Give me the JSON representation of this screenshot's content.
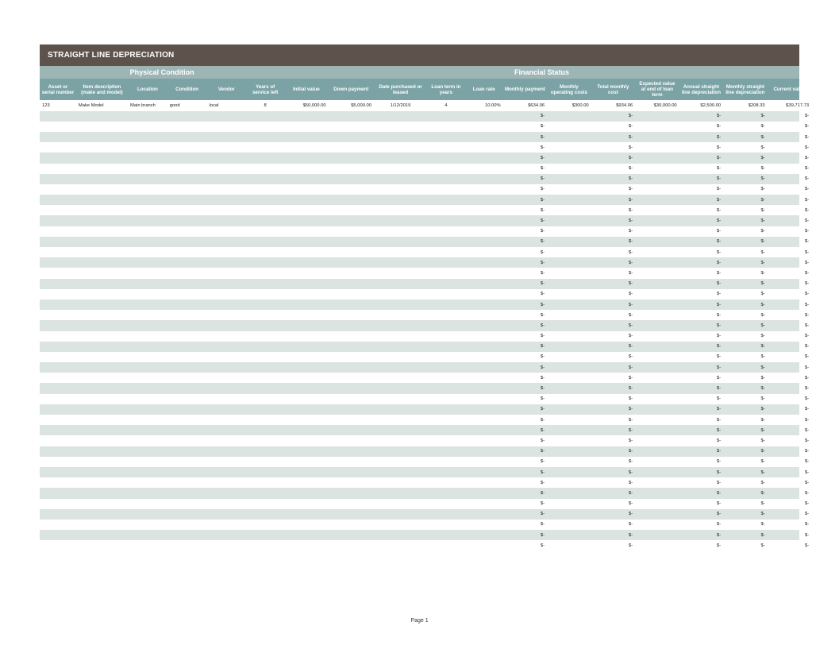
{
  "title": "STRAIGHT LINE DEPRECIATION",
  "groups": {
    "physical": "Physical Condition",
    "financial": "Financial Status"
  },
  "headers": [
    "Asset or serial number",
    "Item description (make and model)",
    "Location",
    "Condition",
    "Vendor",
    "Years of service left",
    "Initial value",
    "Down payment",
    "Date purchased or leased",
    "Loan term in years",
    "Loan rate",
    "Monthly payment",
    "Monthly operating costs",
    "Total monthly cost",
    "Expected value at end of loan term",
    "Annual straight line depreciation",
    "Monthly straight line depreciation",
    "Current value"
  ],
  "first_row": {
    "asset_serial": "123",
    "item_description": "Make Model",
    "location": "Main branch",
    "condition": "good",
    "vendor": "local",
    "years_service_left": "8",
    "initial_value": "$50,000.00",
    "down_payment": "$5,000.00",
    "date_purchased": "1/12/2019",
    "loan_term": "4",
    "loan_rate": "10.00%",
    "monthly_payment": "$634.06",
    "monthly_operating": "$300.00",
    "total_monthly_cost": "$934.06",
    "expected_value_end": "$30,000.00",
    "annual_depr": "$2,500.00",
    "monthly_depr": "$208.33",
    "current_value": "$39,717.73"
  },
  "empty_row_placeholder": "$-",
  "empty_row_count": 42,
  "footer": "Page 1"
}
